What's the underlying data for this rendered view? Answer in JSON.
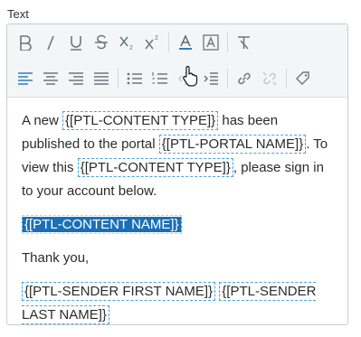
{
  "field": {
    "label": "Text"
  },
  "toolbar": {
    "row1": [
      "bold-icon",
      "italic-icon",
      "underline-icon",
      "strikethrough-icon",
      "subscript-icon",
      "superscript-icon",
      "text-color-icon",
      "background-color-icon",
      "clear-formatting-icon"
    ],
    "row2": [
      "align-left-icon",
      "align-center-icon",
      "align-right-icon",
      "align-justify-icon",
      "bullet-list-icon",
      "numbered-list-icon",
      "outdent-icon",
      "indent-icon",
      "insert-link-icon",
      "remove-link-icon",
      "tag-icon"
    ]
  },
  "content": {
    "p1": {
      "t1": "A new ",
      "ph1": "{[PTL-CONTENT TYPE]}",
      "t2": " has been published to the portal ",
      "ph2": "{[PTL-PORTAL NAME]}",
      "t3": ". To view this ",
      "ph3": "{[PTL-CONTENT TYPE]}",
      "t4": ", please sign in to your account below."
    },
    "p2": {
      "ph": "{[PTL-CONTENT NAME]}"
    },
    "p3": {
      "text": "Thank you,"
    },
    "p4": {
      "ph1": "{[PTL-SENDER FIRST NAME]}",
      "t1": " ",
      "ph2": "{[PTL-SENDER LAST NAME]}"
    }
  }
}
